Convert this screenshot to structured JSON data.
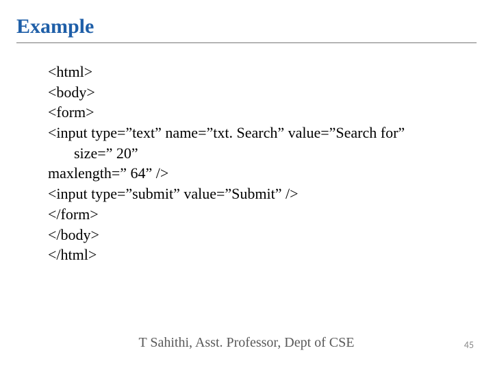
{
  "title": "Example",
  "code": {
    "l1": "<html>",
    "l2": "<body>",
    "l3": "<form>",
    "l4": "<input type=”text” name=”txt. Search” value=”Search for”",
    "l4b": "size=” 20”",
    "l5": "maxlength=” 64” />",
    "l6": "<input type=”submit” value=”Submit” />",
    "l7": "</form>",
    "l8": "</body>",
    "l9": "</html>"
  },
  "footer": {
    "author": "T Sahithi, Asst. Professor, Dept of CSE"
  },
  "page_number": "45"
}
